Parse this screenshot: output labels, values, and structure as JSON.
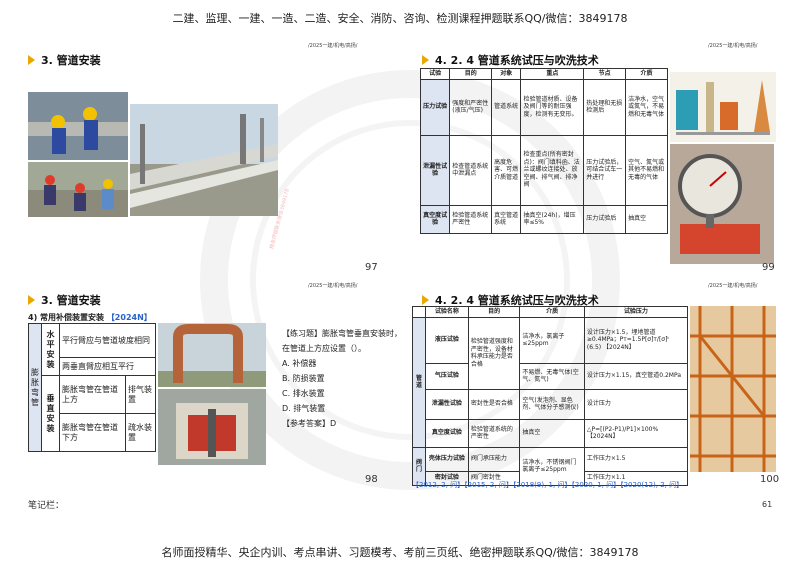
{
  "header_banner": "二建、监理、一建、一造、二造、安全、消防、咨询、检测课程押题联系QQ/微信：3849178",
  "footer_banner": "名师面授精华、央企内训、考点串讲、习题模考、考前三页纸、绝密押题联系QQ/微信：3849178",
  "stamp": "精准押题联系微信3849178",
  "slide_tag": "/2025一建/机电/高扬/",
  "slide1": {
    "title": "3. 管道安装",
    "page": "97"
  },
  "slide2": {
    "title": "4. 2. 4 管道系统试压与吹洗技术",
    "page": "99",
    "headers": [
      "试验",
      "目的",
      "对象",
      "重点",
      "节点",
      "介质"
    ],
    "rows": [
      {
        "name": "压力试验",
        "purpose": "强度和严密性(液压/气压)",
        "object": "管道系统",
        "focus": "检验管道材质、设备及阀门等的耐压强度，检测有无变形。",
        "node": "热处理和无损检测后",
        "medium": "洁净水，空气或氮气，不易燃和无毒气体"
      },
      {
        "name": "泄漏性试验",
        "purpose": "检查管道系统中泄漏点",
        "object": "高度危害、可燃介质管道",
        "focus": "检查重点(所有密封点)：阀门填料函、法兰或螺纹连接处、放空阀、排气阀、排净阀",
        "node": "压力试验后，可结合试车一并进行",
        "medium": "空气、氮气或其他不易燃和无毒的气体"
      },
      {
        "name": "真空度试验",
        "purpose": "检验管道系统严密性",
        "object": "真空管道系统",
        "focus": "抽真空(24h)，增压率≤5%",
        "node": "压力试验后",
        "medium": "抽真空"
      }
    ]
  },
  "slide3": {
    "title": "3. 管道安装",
    "subtitle": "4) 常用补偿装置安装",
    "subtitle_tag": "【2024N】",
    "group": "膨胀弯管",
    "rows": [
      {
        "main": "水平安装",
        "sub": "平行臂应与管道坡度相同"
      },
      {
        "main": "",
        "sub": "两垂直臂应相互平行"
      },
      {
        "main": "垂直安装",
        "sub": "膨胀弯管在管道上方",
        "device": "排气装置"
      },
      {
        "main": "",
        "sub": "膨胀弯管在管道下方",
        "device": "疏水装置"
      }
    ],
    "question": {
      "label": "【练习题】膨胀弯管垂直安装时，在管道上方应设置（）。",
      "options": [
        "A. 补偿器",
        "B. 防损装置",
        "C. 排水装置",
        "D. 排气装置"
      ],
      "answer": "【参考答案】D"
    },
    "page": "98"
  },
  "slide4": {
    "title": "4. 2. 4 管道系统试压与吹洗技术",
    "headers": [
      "试验名称",
      "目的",
      "介质",
      "试验压力"
    ],
    "group1": "管道",
    "group2": "阀门",
    "rows": [
      {
        "name": "液压试验",
        "purpose": "检验管道强度和严密性，设备材料承压能力是否合格",
        "medium": "洁净水，氯离子≤25ppm",
        "pressure": "设计压力×1.5，埋地管道≥0.4MPa；Pт=1.5P[σ]т/[σ]ᵗ (6.5) 【2024N】"
      },
      {
        "name": "气压试验",
        "purpose": "",
        "medium": "不易燃、无毒气体(空气、氮气)",
        "pressure": "设计压力×1.15，真空管道0.2MPa"
      },
      {
        "name": "泄漏性试验",
        "purpose": "密封性是否合格",
        "medium": "空气(发泡剂、显色剂、气体分子感测仪)",
        "pressure": "设计压力"
      },
      {
        "name": "真空度试验",
        "purpose": "检验管道系统的严密性",
        "medium": "抽真空",
        "pressure": "△P=[(P2-P1)/P1]×100% 【2024N】"
      },
      {
        "name": "壳体压力试验",
        "purpose": "阀门承压能力",
        "medium": "洁净水，不锈钢阀门氯离子≤25ppm",
        "pressure": "工作压力×1.5"
      },
      {
        "name": "密封试验",
        "purpose": "阀门密封性",
        "medium": "",
        "pressure": "工作压力×1.1"
      }
    ],
    "years": "【2012, 2, 问】【2015, 2, 问】【2018(9), 1, 问】【2020, 1, 问】【2020(12), 2, 问】",
    "page": "100"
  },
  "notes_label": "笔记栏：",
  "sheet_page": "61"
}
